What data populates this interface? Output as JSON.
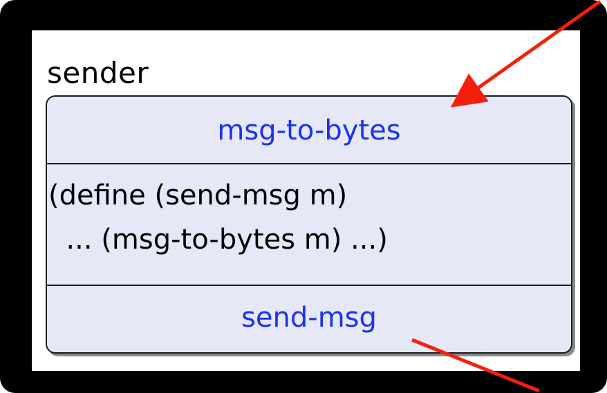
{
  "module": {
    "name": "sender",
    "imports": [
      "msg-to-bytes"
    ],
    "body_lines": [
      "(define (send-msg m)",
      "  ... (msg-to-bytes m) ...)"
    ],
    "exports": [
      "send-msg"
    ]
  },
  "colors": {
    "frame": "#000000",
    "box_fill": "#e6e8f8",
    "identifier": "#1b32ee",
    "arrow": "#f5200c"
  },
  "arrows": [
    {
      "name": "incoming-import-arrow",
      "direction": "in",
      "target": "msg-to-bytes"
    },
    {
      "name": "outgoing-export-arrow",
      "direction": "out",
      "source": "send-msg"
    }
  ]
}
